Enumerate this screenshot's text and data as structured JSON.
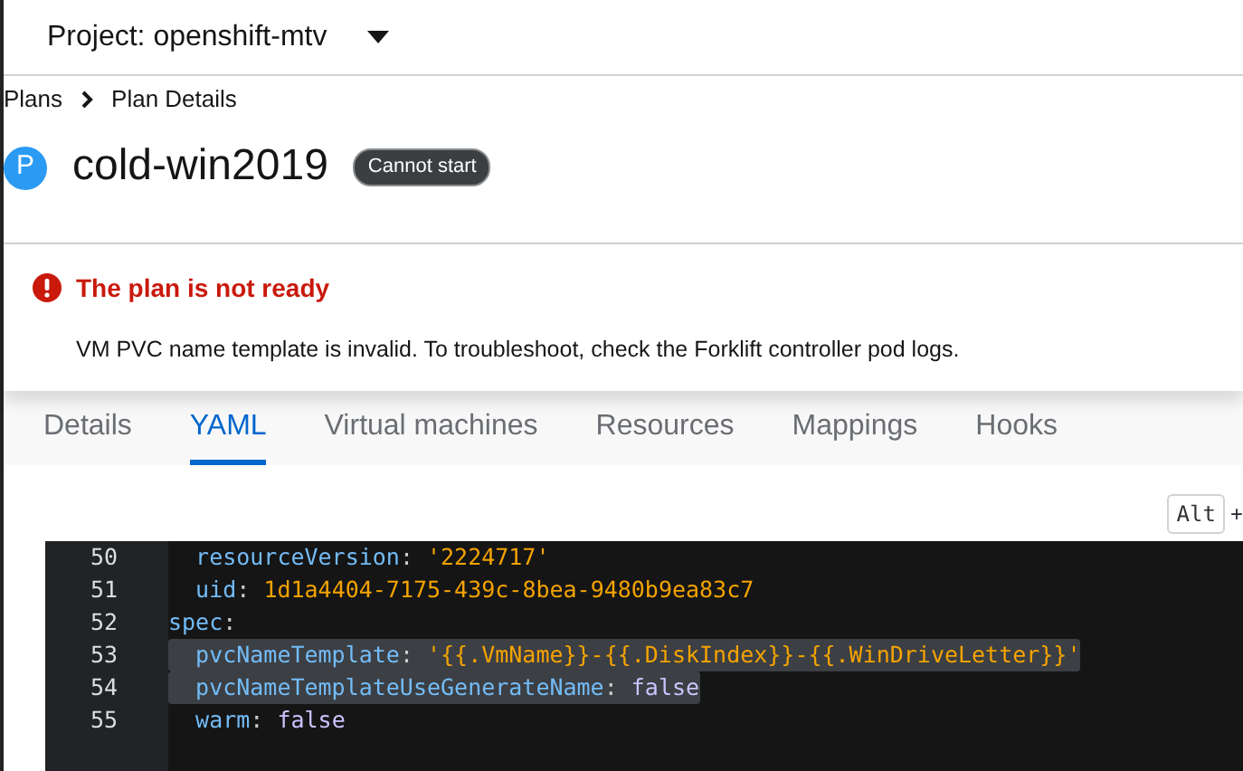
{
  "project_selector": {
    "label": "Project: openshift-mtv"
  },
  "breadcrumb": [
    {
      "label": "Plans"
    },
    {
      "label": "Plan Details"
    }
  ],
  "header": {
    "badge_letter": "P",
    "title": "cold-win2019",
    "status": "Cannot start"
  },
  "alert": {
    "title": "The plan is not ready",
    "message": "VM PVC name template is invalid. To troubleshoot, check the Forklift controller pod logs."
  },
  "tabs": [
    {
      "label": "Details",
      "selected": false
    },
    {
      "label": "YAML",
      "selected": true
    },
    {
      "label": "Virtual machines",
      "selected": false
    },
    {
      "label": "Resources",
      "selected": false
    },
    {
      "label": "Mappings",
      "selected": false
    },
    {
      "label": "Hooks",
      "selected": false
    }
  ],
  "shortcut_hint": {
    "key": "Alt",
    "plus": "+"
  },
  "editor": {
    "lines": [
      {
        "number": "50",
        "highlighted": false,
        "tokens": [
          {
            "kind": "key",
            "text": "  resourceVersion"
          },
          {
            "kind": "punct",
            "text": ": "
          },
          {
            "kind": "string",
            "text": "'2224717'"
          }
        ]
      },
      {
        "number": "51",
        "highlighted": false,
        "tokens": [
          {
            "kind": "key",
            "text": "  uid"
          },
          {
            "kind": "punct",
            "text": ": "
          },
          {
            "kind": "string",
            "text": "1d1a4404-7175-439c-8bea-9480b9ea83c7"
          }
        ]
      },
      {
        "number": "52",
        "highlighted": false,
        "tokens": [
          {
            "kind": "key",
            "text": "spec"
          },
          {
            "kind": "punct",
            "text": ":"
          }
        ]
      },
      {
        "number": "53",
        "highlighted": true,
        "tokens": [
          {
            "kind": "key",
            "text": "  pvcNameTemplate"
          },
          {
            "kind": "punct",
            "text": ": "
          },
          {
            "kind": "string",
            "text": "'{{.VmName}}-{{.DiskIndex}}-{{.WinDriveLetter}}'"
          }
        ]
      },
      {
        "number": "54",
        "highlighted": true,
        "tokens": [
          {
            "kind": "key",
            "text": "  pvcNameTemplateUseGenerateName"
          },
          {
            "kind": "punct",
            "text": ": "
          },
          {
            "kind": "boolean",
            "text": "false"
          }
        ]
      },
      {
        "number": "55",
        "highlighted": false,
        "tokens": [
          {
            "kind": "key",
            "text": "  warm"
          },
          {
            "kind": "punct",
            "text": ": "
          },
          {
            "kind": "boolean",
            "text": "false"
          }
        ]
      }
    ]
  }
}
